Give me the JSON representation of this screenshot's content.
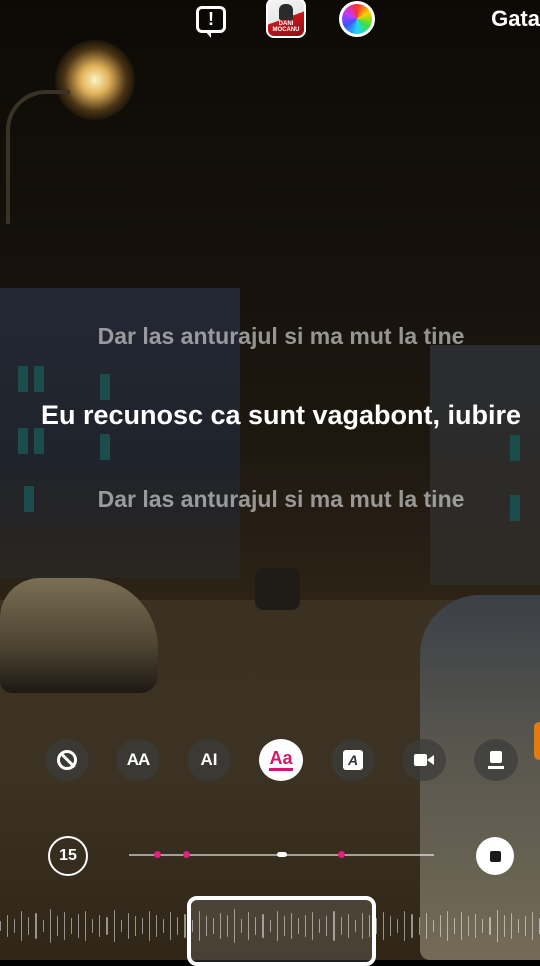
{
  "topbar": {
    "report_icon": "exclamation-bubble-icon",
    "album_text": "DANI MOCANU",
    "color_picker_icon": "color-wheel-icon",
    "done_label": "Gata"
  },
  "lyrics": {
    "previous": "Dar las anturajul si ma mut la tine",
    "current": "Eu recunosc ca sunt vagabont, iubire",
    "next": "Dar las anturajul si ma mut la tine"
  },
  "styles": {
    "items": [
      {
        "name": "none",
        "icon": "no-style-icon"
      },
      {
        "name": "typewriter-caps",
        "label": "AA"
      },
      {
        "name": "cursor-caps",
        "label": "AI"
      },
      {
        "name": "highlight",
        "label": "Aa",
        "selected": true
      },
      {
        "name": "boxed",
        "label": "A"
      },
      {
        "name": "camera-card",
        "icon": "camera-icon"
      },
      {
        "name": "card",
        "icon": "card-icon"
      }
    ]
  },
  "player": {
    "duration_label": "15",
    "stop_icon": "stop-icon"
  },
  "colors": {
    "accent": "#d0196e",
    "marker": "#e0207a"
  }
}
